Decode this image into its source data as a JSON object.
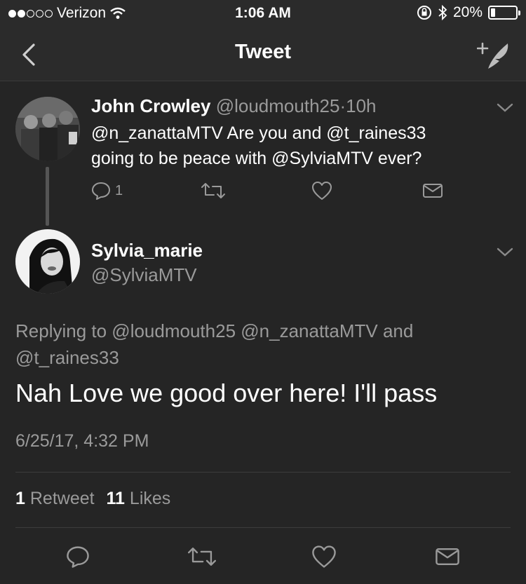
{
  "status_bar": {
    "carrier": "Verizon",
    "time": "1:06 AM",
    "battery": "20%",
    "signal_icon": "signal-dots-icon",
    "wifi_icon": "wifi-icon",
    "lock_icon": "rotation-lock-icon",
    "bluetooth_icon": "bluetooth-icon"
  },
  "nav": {
    "title": "Tweet",
    "back_icon": "chevron-left-icon",
    "compose_icon": "compose-tweet-icon"
  },
  "parent_tweet": {
    "author_name": "John Crowley",
    "author_handle": "@loudmouth25",
    "separator": "·",
    "age": "10h",
    "text_line1": "@n_zanattaMTV Are you and @t_raines33",
    "text_line2": "going to be peace with @SylviaMTV ever?",
    "reply_count": "1"
  },
  "main_tweet": {
    "author_name": "Sylvia_marie",
    "author_handle": "@SylviaMTV",
    "replying_line1": "Replying to @loudmouth25 @n_zanattaMTV and",
    "replying_line2": "@t_raines33",
    "text": "Nah Love we good over here! I'll pass",
    "timestamp": "6/25/17, 4:32 PM",
    "retweet_count": "1",
    "retweet_label": "Retweet",
    "like_count": "11",
    "like_label": "Likes"
  },
  "colors": {
    "background": "#252525",
    "text_primary": "#ffffff",
    "text_secondary": "#9a9a9a"
  }
}
